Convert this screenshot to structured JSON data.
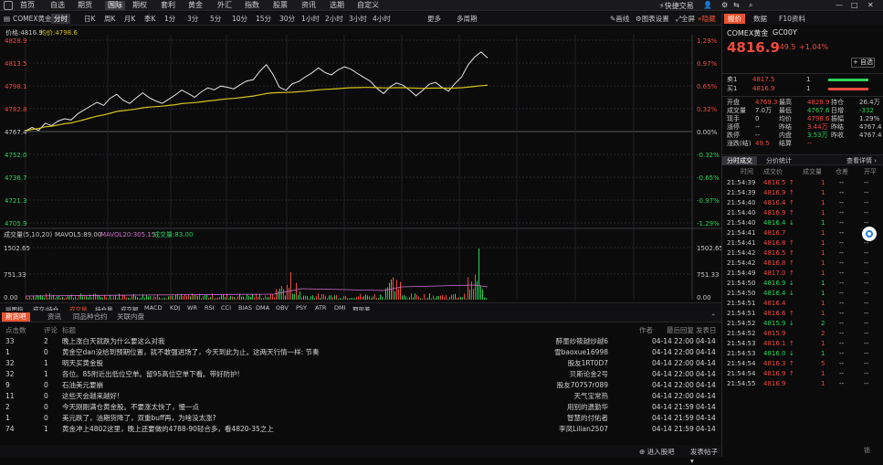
{
  "nav": {
    "items": [
      "首页",
      "自选",
      "期货",
      "国际",
      "期权",
      "套利",
      "黄金",
      "外汇",
      "指数",
      "股票",
      "资讯",
      "选期",
      "自定义"
    ],
    "active_index": 3,
    "quick_trade": "快捷交易"
  },
  "toolbar": {
    "symbol": "COMEX黄金",
    "items": [
      "分时",
      "日K",
      "周K",
      "月K",
      "季K",
      "1分",
      "3分",
      "5分",
      "10分",
      "15分",
      "30分",
      "1小时",
      "2小时",
      "3小时",
      "4小时",
      "更多",
      "多周期"
    ],
    "active_index": 0,
    "draw": "画线",
    "settings": "图表设置",
    "fullscreen": "全屏",
    "hide": "隐藏"
  },
  "chart_info": {
    "price_label": "价格:4816.9",
    "avg_label": "均价:4798.6"
  },
  "chart_data": {
    "type": "line",
    "y_ticks": [
      "4828.9",
      "4813.5",
      "4798.1",
      "4782.8",
      "4767.4",
      "4752.0",
      "4736.7",
      "4721.3",
      "4705.9"
    ],
    "pct_ticks": [
      "1.29%",
      "0.97%",
      "0.65%",
      "0.32%",
      "0.00%",
      "-0.32%",
      "-0.65%",
      "-0.97%",
      "-1.29%"
    ],
    "ylim": [
      4705.9,
      4828.9
    ],
    "x_ticks": [
      "06:00",
      "07:00",
      "08:00",
      "09:00",
      "10:00",
      "11:00",
      "12:00",
      "13:00",
      "14:00",
      "15:00",
      "16:00",
      "17:00",
      "18:00",
      "19:00",
      "20:00",
      "21:00",
      "22:00",
      "23:00",
      "00:00",
      "01:00",
      "02:00",
      "03:00",
      "04:00",
      "05:00"
    ],
    "series": [
      {
        "values": [
          4767.8,
          4770.2,
          4768.1,
          4773.0,
          4771.4,
          4774.5,
          4776.0,
          4775.2,
          4779.3,
          4782.0,
          4784.6,
          4787.1,
          4785.0,
          4789.8,
          4792.4,
          4788.5,
          4786.3,
          4790.1,
          4793.5,
          4790.2,
          4788.0,
          4786.4,
          4789.2,
          4792.0,
          4795.3,
          4793.0,
          4790.5,
          4794.1,
          4796.8,
          4795.5,
          4798.0,
          4797.2,
          4796.1,
          4799.0,
          4801.5,
          4802.3,
          4808.0,
          4812.4,
          4806.1,
          4797.3,
          4795.2,
          4799.6,
          4801.1,
          4804.3,
          4806.9,
          4810.3,
          4807.2,
          4805.5,
          4808.9,
          4811.0,
          4809.4,
          4806.5,
          4803.8,
          4801.2,
          4796.5,
          4793.0,
          4797.5,
          4800.1,
          4798.6,
          4795.3,
          4791.5,
          4795.0,
          4799.2,
          4800.5,
          4797.1,
          4794.6,
          4799.8,
          4804.1,
          4812.3,
          4817.5,
          4821.0,
          4816.9
        ]
      },
      {
        "values": [
          4767.8,
          4768.9,
          4769.5,
          4770.6,
          4771.0,
          4771.8,
          4772.7,
          4773.2,
          4774.3,
          4775.4,
          4776.6,
          4777.8,
          4778.6,
          4779.7,
          4780.9,
          4781.5,
          4782.0,
          4782.6,
          4783.4,
          4783.9,
          4784.2,
          4784.5,
          4785.0,
          4785.5,
          4786.2,
          4786.6,
          4786.9,
          4787.4,
          4788.0,
          4788.4,
          4789.0,
          4789.4,
          4789.7,
          4790.2,
          4790.8,
          4791.3,
          4792.1,
          4793.0,
          4793.5,
          4793.6,
          4793.7,
          4793.9,
          4794.2,
          4794.6,
          4795.0,
          4795.5,
          4795.8,
          4796.0,
          4796.3,
          4796.6,
          4796.9,
          4797.0,
          4797.1,
          4797.1,
          4797.0,
          4796.8,
          4796.8,
          4796.9,
          4796.9,
          4796.8,
          4796.6,
          4796.5,
          4796.6,
          4796.7,
          4796.7,
          4796.6,
          4796.7,
          4796.9,
          4797.3,
          4797.8,
          4798.3,
          4798.6
        ]
      }
    ]
  },
  "volume": {
    "header": "成交量(5,10,20)",
    "mavol5": "MAVOL5:89.00",
    "mavol20": "MAVOL20:305.15",
    "vol": "成交量:83.00",
    "ticks": [
      "1502.65",
      "751.33",
      "0.00"
    ]
  },
  "indicators": [
    "副图指",
    "成交/持仓",
    "成交量",
    "持仓量",
    "成交额",
    "MACD",
    "KDJ",
    "WR",
    "RSI",
    "CCI",
    "BIAS",
    "DMA",
    "OBV",
    "PSY",
    "ATR",
    "DMI",
    "期现差"
  ],
  "news": {
    "tabs": [
      "期货吧",
      "资讯",
      "同品种合约",
      "关联内盘"
    ],
    "headers": [
      "点击数",
      "评论",
      "标题",
      "作者",
      "最后回复",
      "发表日"
    ],
    "rows": [
      {
        "clicks": "33",
        "comments": "2",
        "title": "晚上涨白天就跌为什么要这么对我",
        "author": "醉墨纱筱越炒越6",
        "time": "04-14 22:00",
        "date": "04-14"
      },
      {
        "clicks": "1",
        "comments": "0",
        "title": "黄金空dan没给到预期位置，就不敢强进场了，今天到此为止。这两天行情一样: 节奏",
        "author": "雪baoxue16998",
        "time": "04-14 22:00",
        "date": "04-14"
      },
      {
        "clicks": "32",
        "comments": "1",
        "title": "明天买黄金股",
        "author": "股友1RT0D7",
        "time": "04-14 22:00",
        "date": "04-14"
      },
      {
        "clicks": "32",
        "comments": "1",
        "title": "各位。85附近出低位空单。留95高位空单下看。带好防护!",
        "author": "贝斯论金2号",
        "time": "04-14 22:00",
        "date": "04-14"
      },
      {
        "clicks": "9",
        "comments": "0",
        "title": "石油美元要崩",
        "author": "股友70757r089",
        "time": "04-14 22:00",
        "date": "04-14"
      },
      {
        "clicks": "11",
        "comments": "0",
        "title": "这些天会越来越好!",
        "author": "天气宝常热",
        "time": "04-14 22:00",
        "date": "04-14"
      },
      {
        "clicks": "2",
        "comments": "0",
        "title": "今天刚刚满仓黄金股。不要涨太快了，慢一点",
        "author": "用别的遗勤华",
        "time": "04-14 21:59",
        "date": "04-14"
      },
      {
        "clicks": "1",
        "comments": "0",
        "title": "美元跌了，油期货降了，双重buff再，为啥没太涨?",
        "author": "智慧的付佑者",
        "time": "04-14 21:59",
        "date": "04-14"
      },
      {
        "clicks": "74",
        "comments": "1",
        "title": "黄金冲上4802这里，晚上还要做的4788-90轻合多，看4820-35之上",
        "author": "李凤Lilian2507",
        "time": "04-14 21:59",
        "date": "04-14"
      }
    ],
    "enter_forum": "进入股吧",
    "post": "发表帖子"
  },
  "right": {
    "tabs": [
      "报价",
      "数据",
      "F10资料"
    ],
    "name": "COMEX黄金",
    "code": "GC00Y",
    "price": "4816.9",
    "change": "+49.5",
    "change_pct": "+1.04%",
    "fav": "自选",
    "sell1": {
      "label": "卖1",
      "price": "4817.5",
      "qty": "1"
    },
    "buy1": {
      "label": "买1",
      "price": "4816.9",
      "qty": "1"
    },
    "stats": [
      [
        "开盘",
        "4769.3",
        "最高",
        "4828.9",
        "持仓",
        "26.4万"
      ],
      [
        "成交量",
        "7.0万",
        "最低",
        "4767.6",
        "日增",
        "-332"
      ],
      [
        "现手",
        "0",
        "均价",
        "4798.6",
        "振幅",
        "1.29%"
      ],
      [
        "涨停",
        "--",
        "昨结",
        "3.44万",
        "昨结",
        "4767.4"
      ],
      [
        "跌停",
        "--",
        "内盘",
        "3.53万",
        "昨收",
        "4767.4"
      ],
      [
        "涨跌(结)",
        "49.5",
        "结算",
        "--",
        "",
        ""
      ]
    ],
    "trade_tabs": [
      "分时成交",
      "分价统计"
    ],
    "detail_link": "查看详情",
    "trade_headers": [
      "时间",
      "成交价",
      "成交量",
      "仓差",
      "开平"
    ],
    "trades": [
      {
        "time": "21:54:39",
        "price": "4816.5",
        "dir": "up",
        "vol": "1"
      },
      {
        "time": "21:54:39",
        "price": "4816.9",
        "dir": "up",
        "vol": "1"
      },
      {
        "time": "21:54:40",
        "price": "4816.4",
        "dir": "up",
        "vol": "1"
      },
      {
        "time": "21:54:40",
        "price": "4816.9",
        "dir": "up",
        "vol": "1"
      },
      {
        "time": "21:54:40",
        "price": "4816.4",
        "dir": "down",
        "vol": "1"
      },
      {
        "time": "21:54:41",
        "price": "4816.7",
        "dir": "",
        "vol": "1"
      },
      {
        "time": "21:54:41",
        "price": "4816.8",
        "dir": "up",
        "vol": "1"
      },
      {
        "time": "21:54:42",
        "price": "4816.5",
        "dir": "up",
        "vol": "1"
      },
      {
        "time": "21:54:42",
        "price": "4816.8",
        "dir": "up",
        "vol": "1"
      },
      {
        "time": "21:54:49",
        "price": "4817.0",
        "dir": "up",
        "vol": "1"
      },
      {
        "time": "21:54:50",
        "price": "4816.9",
        "dir": "down",
        "vol": "1"
      },
      {
        "time": "21:54:50",
        "price": "4816.4",
        "dir": "down",
        "vol": "1"
      },
      {
        "time": "21:54:51",
        "price": "4816.4",
        "dir": "",
        "vol": "1"
      },
      {
        "time": "21:54:51",
        "price": "4816.6",
        "dir": "up",
        "vol": "1"
      },
      {
        "time": "21:54:52",
        "price": "4815.9",
        "dir": "down",
        "vol": "2"
      },
      {
        "time": "21:54:52",
        "price": "4815.9",
        "dir": "",
        "vol": "2"
      },
      {
        "time": "21:54:53",
        "price": "4816.1",
        "dir": "up",
        "vol": "1"
      },
      {
        "time": "21:54:53",
        "price": "4816.0",
        "dir": "down",
        "vol": "1"
      },
      {
        "time": "21:54:54",
        "price": "4816.3",
        "dir": "up",
        "vol": "5"
      },
      {
        "time": "21:54:54",
        "price": "4816.9",
        "dir": "up",
        "vol": "1"
      },
      {
        "time": "21:54:55",
        "price": "4816.9",
        "dir": "",
        "vol": "1"
      }
    ],
    "bottom_btn": "锁"
  },
  "colors": {
    "up": "#ef4a3c",
    "down": "#2bd45a",
    "price_line": "#e6e6e6",
    "avg_line": "#d4c21a",
    "accent": "#e9532f"
  }
}
